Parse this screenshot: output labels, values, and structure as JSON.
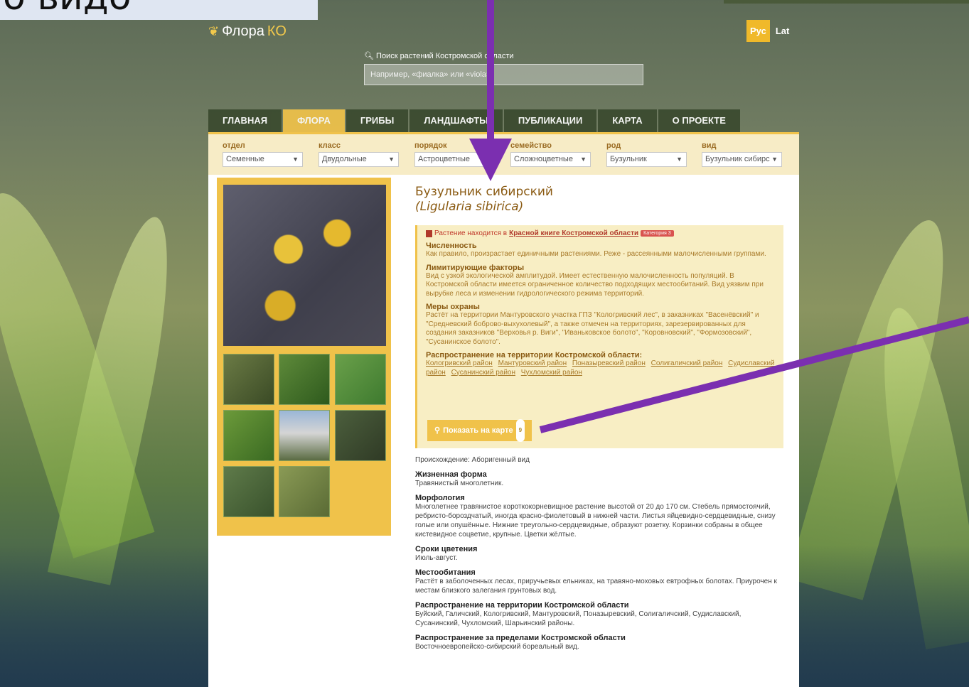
{
  "overlay": {
    "caption": "о видо"
  },
  "header": {
    "logo_prefix": "Флора",
    "logo_suffix": "КО",
    "lang_active": "Рус",
    "lang_other": "Lat"
  },
  "search": {
    "label": "Поиск растений Костромской области",
    "placeholder": "Например, «фиалка» или «viola»"
  },
  "nav": [
    {
      "label": "ГЛАВНАЯ"
    },
    {
      "label": "ФЛОРА"
    },
    {
      "label": "ГРИБЫ"
    },
    {
      "label": "ЛАНДШАФТЫ"
    },
    {
      "label": "ПУБЛИКАЦИИ"
    },
    {
      "label": "КАРТА"
    },
    {
      "label": "О ПРОЕКТЕ"
    }
  ],
  "filters": [
    {
      "label": "отдел",
      "value": "Семенные"
    },
    {
      "label": "класс",
      "value": "Двудольные"
    },
    {
      "label": "порядок",
      "value": "Астроцветные"
    },
    {
      "label": "семейство",
      "value": "Сложноцветные"
    },
    {
      "label": "род",
      "value": "Бузульник"
    },
    {
      "label": "вид",
      "value": "Бузульник сибирс"
    }
  ],
  "plant": {
    "title": "Бузульник сибирский",
    "latin": "(Ligularia sibirica)"
  },
  "redbook": {
    "prefix": "Растение находится в",
    "link": "Красной книге Костромской области",
    "badge": "Категория 3",
    "sections": [
      {
        "head": "Численность",
        "text": "Как правило, произрастает единичными растениями. Реже - рассеянными малочисленными группами."
      },
      {
        "head": "Лимитирующие факторы",
        "text": "Вид с узкой экологической амплитудой. Имеет естественную малочисленность популяций. В Костромской области имеется ограниченное количество подходящих местообитаний. Вид уязвим при вырубке леса и изменении гидрологического режима территорий."
      },
      {
        "head": "Меры охраны",
        "text": "Растёт на территории Мантуровского участка ГПЗ \"Кологривский лес\", в заказниках \"Васенёвский\" и \"Средневский боброво-выхухолевый\", а также отмечен на территориях, зарезервированных для создания заказников \"Верховья р. Виги\", \"Иваньковское болото\", \"Коровновский\", \"Формозовский\", \"Сусанинское болото\"."
      }
    ],
    "areas_head": "Распространение на территории Костромской области:",
    "areas": [
      "Кологривский район",
      "Мантуровский район",
      "Поназыревский район",
      "Солигаличский район",
      "Судиславский район",
      "Сусанинский район",
      "Чухломский район"
    ],
    "map_button": "Показать на карте",
    "map_count": "9"
  },
  "details": {
    "origin": "Происхождение: Аборигенный вид",
    "sections": [
      {
        "head": "Жизненная форма",
        "text": "Травянистый многолетник."
      },
      {
        "head": "Морфология",
        "text": "Многолетнее травянистое короткокорневищное растение высотой от 20 до 170 см. Стебель прямостоячий, ребристо-бороздчатый, иногда красно-фиолетовый в нижней части. Листья яйцевидно-сердцевидные, снизу голые или опушённые. Нижние треугольно-сердцевидные, образуют розетку. Корзинки собраны в общее кистевидное соцветие, крупные. Цветки жёлтые."
      },
      {
        "head": "Сроки цветения",
        "text": "Июль-август."
      },
      {
        "head": "Местообитания",
        "text": "Растёт в заболоченных лесах, приручьевых ельниках, на травяно-моховых евтрофных болотах. Приурочен к местам близкого залегания грунтовых вод."
      },
      {
        "head": "Распространение на территории Костромской области",
        "text": "Буйский, Галичский, Кологривский, Мантуровский, Поназыревский, Солигаличский, Судиславский, Сусанинский, Чухломский, Шарьинский районы."
      },
      {
        "head": "Распространение за пределами Костромской области",
        "text": "Восточноевропейско-сибирский бореальный вид."
      }
    ]
  },
  "colors": {
    "accent": "#f0c24a",
    "title": "#8a5a12",
    "redbook_bg": "#f8eec4",
    "arrow": "#7b2fb0"
  }
}
